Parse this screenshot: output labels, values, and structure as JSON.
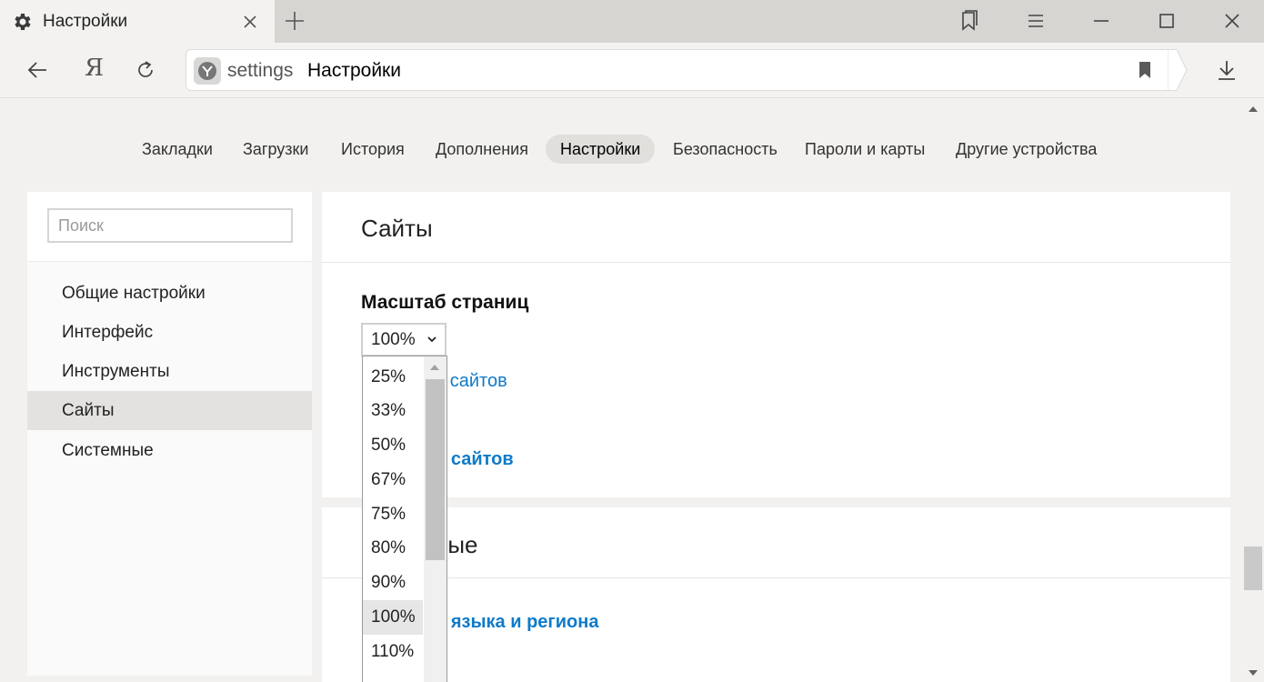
{
  "window": {
    "tab_title": "Настройки"
  },
  "toolbar": {
    "ya_logo": "Я",
    "url_host": "settings",
    "url_title": "Настройки"
  },
  "settings_nav": [
    {
      "label": "Закладки"
    },
    {
      "label": "Загрузки"
    },
    {
      "label": "История"
    },
    {
      "label": "Дополнения"
    },
    {
      "label": "Настройки",
      "active": true
    },
    {
      "label": "Безопасность"
    },
    {
      "label": "Пароли и карты"
    },
    {
      "label": "Другие устройства"
    }
  ],
  "sidebar": {
    "search_placeholder": "Поиск",
    "items": [
      {
        "label": "Общие настройки"
      },
      {
        "label": "Интерфейс"
      },
      {
        "label": "Инструменты"
      },
      {
        "label": "Сайты",
        "active": true
      },
      {
        "label": "Системные"
      }
    ]
  },
  "main": {
    "sites_title": "Сайты",
    "zoom_section_title": "Масштаб страниц",
    "zoom_value": "100%",
    "link_partial_1": "и сайтов",
    "link_partial_2": "и сайтов",
    "system_title_partial": "ные",
    "link_partial_3": "и языка и региона"
  },
  "zoom_options": [
    "25%",
    "33%",
    "50%",
    "67%",
    "75%",
    "80%",
    "90%",
    "100%",
    "110%"
  ],
  "zoom_selected": "100%",
  "colors": {
    "link": "#0f7ac9",
    "active_bg": "#e3e2e0"
  }
}
